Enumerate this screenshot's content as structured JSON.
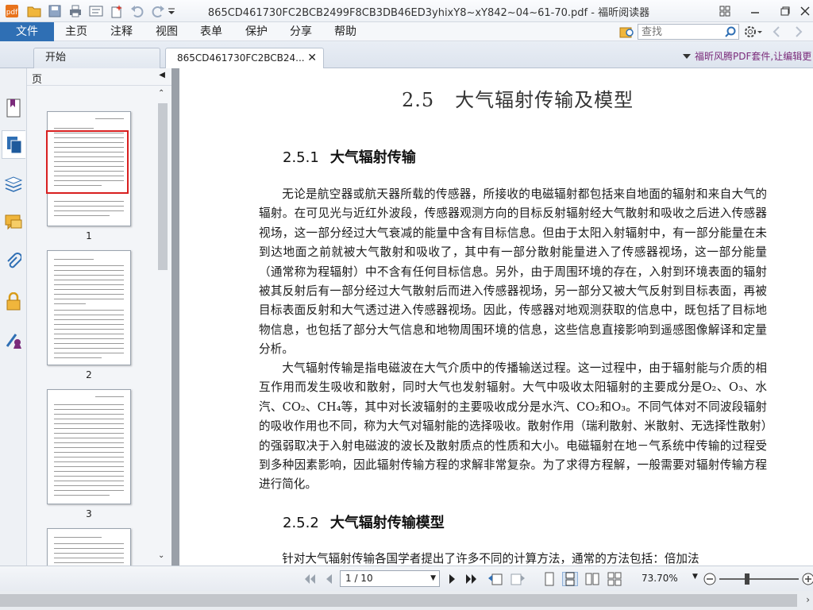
{
  "window": {
    "title": "865CD461730FC2BCB2499F8CB3DB46ED3yhixY8~xY842~04~61-70.pdf - 福昕阅读器"
  },
  "menu": {
    "file": "文件",
    "items": [
      "主页",
      "注释",
      "视图",
      "表单",
      "保护",
      "分享",
      "帮助"
    ]
  },
  "search": {
    "placeholder": "查找"
  },
  "tabs": {
    "home": "开始",
    "doc": "865CD461730FC2BCB24..."
  },
  "promo": "福昕风腾PDF套件,让编辑更",
  "thumbnails": {
    "panel_title": "页",
    "pages": [
      "1",
      "2",
      "3"
    ]
  },
  "document": {
    "section_number": "2.5",
    "section_title": "大气辐射传输及模型",
    "sub1_number": "2.5.1",
    "sub1_title": "大气辐射传输",
    "para1": "无论是航空器或航天器所载的传感器，所接收的电磁辐射都包括来自地面的辐射和来自大气的辐射。在可见光与近红外波段，传感器观测方向的目标反射辐射经大气散射和吸收之后进入传感器视场，这一部分经过大气衰减的能量中含有目标信息。但由于太阳入射辐射中，有一部分能量在未到达地面之前就被大气散射和吸收了，其中有一部分散射能量进入了传感器视场，这一部分能量（通常称为程辐射）中不含有任何目标信息。另外，由于周围环境的存在，入射到环境表面的辐射被其反射后有一部分经过大气散射后而进入传感器视场，另一部分又被大气反射到目标表面，再被目标表面反射和大气透过进入传感器视场。因此，传感器对地观测获取的信息中，既包括了目标地物信息，也包括了部分大气信息和地物周围环境的信息，这些信息直接影响到遥感图像解译和定量分析。",
    "para2": "大气辐射传输是指电磁波在大气介质中的传播输送过程。这一过程中，由于辐射能与介质的相互作用而发生吸收和散射，同时大气也发射辐射。大气中吸收太阳辐射的主要成分是O₂、O₃、水汽、CO₂、CH₄等，其中对长波辐射的主要吸收成分是水汽、CO₂和O₃。不同气体对不同波段辐射的吸收作用也不同，称为大气对辐射能的选择吸收。散射作用（瑞利散射、米散射、无选择性散射）的强弱取决于入射电磁波的波长及散射质点的性质和大小。电磁辐射在地－气系统中传输的过程受到多种因素影响，因此辐射传输方程的求解非常复杂。为了求得方程解，一般需要对辐射传输方程进行简化。",
    "sub2_number": "2.5.2",
    "sub2_title": "大气辐射传输模型",
    "para3": "针对大气辐射传输各国学者提出了许多不同的计算方法，通常的方法包括：倍加法"
  },
  "navigation": {
    "page_display": "1 / 10",
    "zoom": "73.70%"
  },
  "colors": {
    "accent": "#2f6fb4",
    "viewport_frame": "#d82020",
    "canvas": "#9aa0a8"
  }
}
